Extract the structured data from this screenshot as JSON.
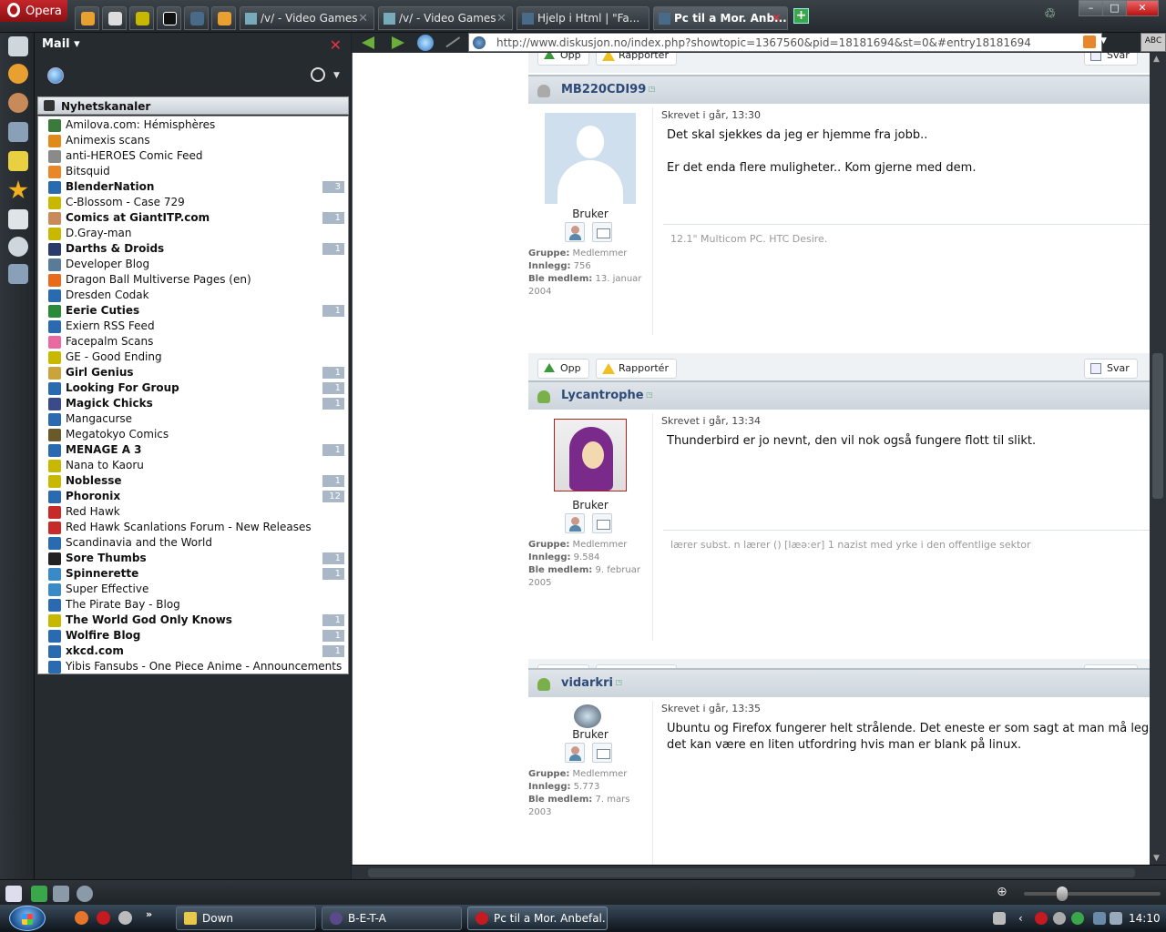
{
  "browser": {
    "menu_label": "Opera",
    "tabs": [
      {
        "label": "/v/ - Video Games"
      },
      {
        "label": "/v/ - Video Games"
      },
      {
        "label": "Hjelp i Html | \"Fa..."
      },
      {
        "label": "Pc til a Mor. Anb..."
      }
    ],
    "url": "http://www.diskusjon.no/index.php?showtopic=1367560&pid=18181694&st=0&#entry18181694",
    "search_label": "ABC"
  },
  "mail_panel": {
    "title": "Mail",
    "title_dropdown": "▾",
    "close": "✕",
    "feeds_header": "Nyhetskanaler",
    "feeds": [
      {
        "name": "Amilova.com: Hémisphères",
        "count": "",
        "unread": false,
        "color": "#3a7a3a"
      },
      {
        "name": "Animexis scans",
        "count": "",
        "unread": false,
        "color": "#e08a1a"
      },
      {
        "name": "anti-HEROES Comic Feed",
        "count": "",
        "unread": false,
        "color": "#8a8a8a"
      },
      {
        "name": "Bitsquid",
        "count": "",
        "unread": false,
        "color": "#e8862a"
      },
      {
        "name": "BlenderNation",
        "count": "3",
        "unread": true,
        "color": "#2a6ab0"
      },
      {
        "name": "C-Blossom - Case 729",
        "count": "",
        "unread": false,
        "color": "#c8b800"
      },
      {
        "name": "Comics at GiantITP.com",
        "count": "1",
        "unread": true,
        "color": "#c98a5a"
      },
      {
        "name": "D.Gray-man",
        "count": "",
        "unread": false,
        "color": "#c8b800"
      },
      {
        "name": "Darths & Droids",
        "count": "1",
        "unread": true,
        "color": "#2a3a6a"
      },
      {
        "name": "Developer Blog",
        "count": "",
        "unread": false,
        "color": "#5a7a9a"
      },
      {
        "name": "Dragon Ball Multiverse Pages (en)",
        "count": "",
        "unread": false,
        "color": "#e86a1a"
      },
      {
        "name": "Dresden Codak",
        "count": "",
        "unread": false,
        "color": "#2a6ab0"
      },
      {
        "name": "Eerie Cuties",
        "count": "1",
        "unread": true,
        "color": "#2a8a3a"
      },
      {
        "name": "Exiern RSS Feed",
        "count": "",
        "unread": false,
        "color": "#2a6ab0"
      },
      {
        "name": "Facepalm Scans",
        "count": "",
        "unread": false,
        "color": "#e86aa0"
      },
      {
        "name": "GE - Good Ending",
        "count": "",
        "unread": false,
        "color": "#c8b800"
      },
      {
        "name": "Girl Genius",
        "count": "1",
        "unread": true,
        "color": "#caa43a"
      },
      {
        "name": "Looking For Group",
        "count": "1",
        "unread": true,
        "color": "#2a6ab0"
      },
      {
        "name": "Magick Chicks",
        "count": "1",
        "unread": true,
        "color": "#3a4a8a"
      },
      {
        "name": "Mangacurse",
        "count": "",
        "unread": false,
        "color": "#2a6ab0"
      },
      {
        "name": "Megatokyo Comics",
        "count": "",
        "unread": false,
        "color": "#6a5a2a"
      },
      {
        "name": "MENAGE A 3",
        "count": "1",
        "unread": true,
        "color": "#2a6ab0"
      },
      {
        "name": "Nana to Kaoru",
        "count": "",
        "unread": false,
        "color": "#c8b800"
      },
      {
        "name": "Noblesse",
        "count": "1",
        "unread": true,
        "color": "#c8b800"
      },
      {
        "name": "Phoronix",
        "count": "12",
        "unread": true,
        "color": "#2a6ab0"
      },
      {
        "name": "Red Hawk",
        "count": "",
        "unread": false,
        "color": "#c82a2a"
      },
      {
        "name": "Red Hawk Scanlations Forum - New Releases",
        "count": "",
        "unread": false,
        "color": "#c82a2a"
      },
      {
        "name": "Scandinavia and the World",
        "count": "",
        "unread": false,
        "color": "#2a6ab0"
      },
      {
        "name": "Sore Thumbs",
        "count": "1",
        "unread": true,
        "color": "#222222"
      },
      {
        "name": "Spinnerette",
        "count": "1",
        "unread": true,
        "color": "#3a8ac8"
      },
      {
        "name": "Super Effective",
        "count": "",
        "unread": false,
        "color": "#3a8ac8"
      },
      {
        "name": "The Pirate Bay - Blog",
        "count": "",
        "unread": false,
        "color": "#2a6ab0"
      },
      {
        "name": "The World God Only Knows",
        "count": "1",
        "unread": true,
        "color": "#c8b800"
      },
      {
        "name": "Wolfire Blog",
        "count": "1",
        "unread": true,
        "color": "#2a6ab0"
      },
      {
        "name": "xkcd.com",
        "count": "1",
        "unread": true,
        "color": "#2a6ab0"
      },
      {
        "name": "Yibis Fansubs - One Piece Anime - Announcements",
        "count": "",
        "unread": false,
        "color": "#2a6ab0"
      }
    ]
  },
  "forum": {
    "buttons": {
      "up": "Opp",
      "report": "Rapportér",
      "reply": "Svar"
    },
    "posts": [
      {
        "author": "MB220CDI99",
        "role": "Bruker",
        "date": "Skrevet i går, 13:30",
        "lines": [
          "Det skal sjekkes da jeg er hjemme fra jobb..",
          "",
          "Er det enda flere muligheter.. Kom gjerne med dem."
        ],
        "signature": "12.1\" Multicom PC. HTC Desire.",
        "group_label": "Gruppe:",
        "group": "Medlemmer",
        "posts_label": "Innlegg:",
        "post_count": "756",
        "joined_label": "Ble medlem:",
        "joined": "13. januar 2004",
        "icon_color": "#aaaaaa"
      },
      {
        "author": "Lycantrophe",
        "role": "Bruker",
        "date": "Skrevet i går, 13:34",
        "lines": [
          "Thunderbird er jo nevnt, den vil nok også fungere flott til slikt."
        ],
        "signature": "lærer subst. n lærer () [læə:er] 1 nazist med yrke i den offentlige sektor",
        "group_label": "Gruppe:",
        "group": "Medlemmer",
        "posts_label": "Innlegg:",
        "post_count": "9.584",
        "joined_label": "Ble medlem:",
        "joined": "9. februar 2005",
        "icon_color": "#7ab04a"
      },
      {
        "author": "vidarkri",
        "role": "Bruker",
        "date": "Skrevet i går, 13:35",
        "lines": [
          "Ubuntu og Firefox fungerer helt strålende. Det eneste er som sagt at man må legge",
          "det kan være en liten utfordring hvis man er blank på linux."
        ],
        "signature": "",
        "group_label": "Gruppe:",
        "group": "Medlemmer",
        "posts_label": "Innlegg:",
        "post_count": "5.773",
        "joined_label": "Ble medlem:",
        "joined": "7. mars 2003",
        "icon_color": "#7ab04a"
      }
    ]
  },
  "taskbar": {
    "tasks": [
      {
        "label": "Down"
      },
      {
        "label": "B-E-T-A"
      },
      {
        "label": "Pc til a Mor. Anbefal..."
      }
    ],
    "clock": "14:10",
    "more": "»"
  }
}
